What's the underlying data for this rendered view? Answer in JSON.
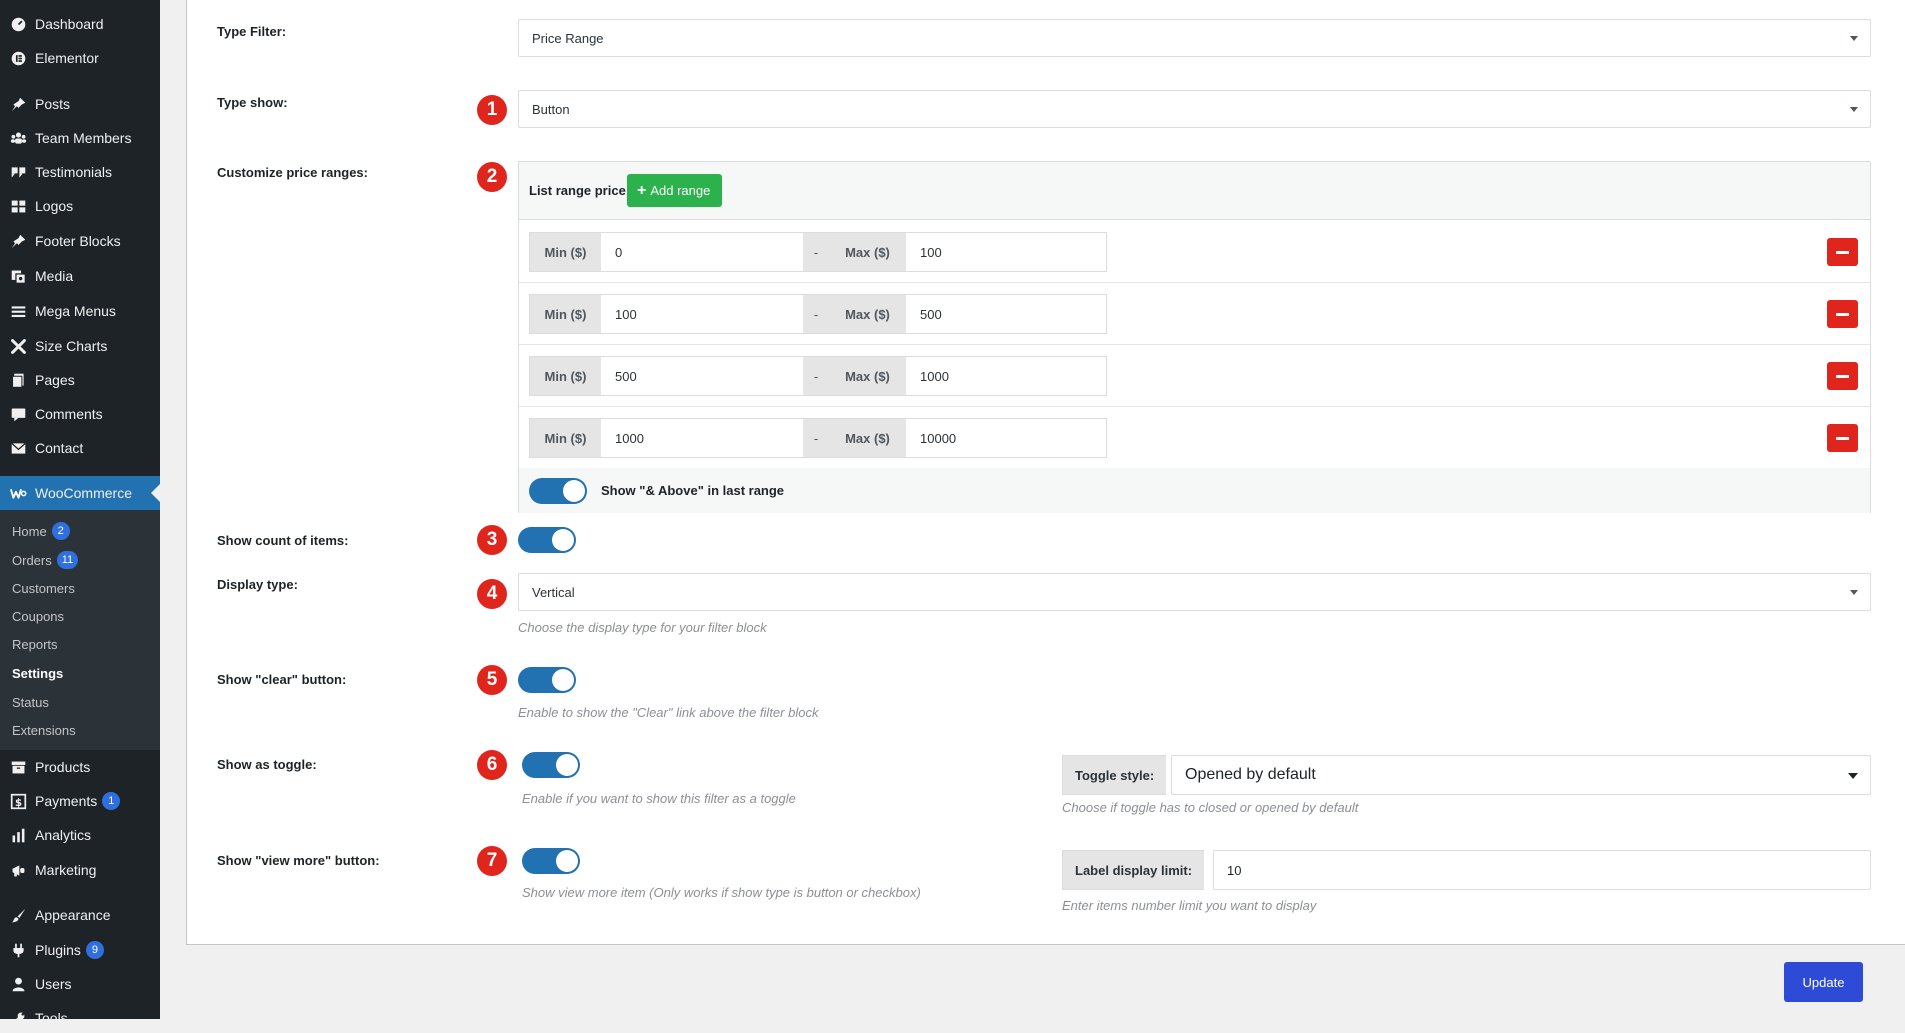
{
  "sidebar": {
    "items": [
      {
        "label": "Dashboard",
        "icon": "dashboard-icon"
      },
      {
        "label": "Elementor",
        "icon": "elementor-icon"
      },
      {
        "label": "Posts",
        "icon": "pin-icon"
      },
      {
        "label": "Team Members",
        "icon": "users-group-icon"
      },
      {
        "label": "Testimonials",
        "icon": "quote-icon"
      },
      {
        "label": "Logos",
        "icon": "grid-icon"
      },
      {
        "label": "Footer Blocks",
        "icon": "pin-icon"
      },
      {
        "label": "Media",
        "icon": "media-icon"
      },
      {
        "label": "Mega Menus",
        "icon": "menu-lines-icon"
      },
      {
        "label": "Size Charts",
        "icon": "tools-icon"
      },
      {
        "label": "Pages",
        "icon": "pages-icon"
      },
      {
        "label": "Comments",
        "icon": "comment-icon"
      },
      {
        "label": "Contact",
        "icon": "mail-icon"
      },
      {
        "label": "WooCommerce",
        "icon": "woo-icon"
      }
    ],
    "woocommerce_submenu": [
      {
        "label": "Home",
        "count": "2"
      },
      {
        "label": "Orders",
        "count": "11"
      },
      {
        "label": "Customers"
      },
      {
        "label": "Coupons"
      },
      {
        "label": "Reports"
      },
      {
        "label": "Settings"
      },
      {
        "label": "Status"
      },
      {
        "label": "Extensions"
      }
    ],
    "bottom_items": [
      {
        "label": "Products",
        "icon": "archive-icon"
      },
      {
        "label": "Payments",
        "icon": "dollar-icon",
        "count": "1"
      },
      {
        "label": "Analytics",
        "icon": "bar-chart-icon"
      },
      {
        "label": "Marketing",
        "icon": "megaphone-icon"
      },
      {
        "label": "Appearance",
        "icon": "brush-icon"
      },
      {
        "label": "Plugins",
        "icon": "plug-icon",
        "count": "9"
      },
      {
        "label": "Users",
        "icon": "user-icon"
      },
      {
        "label": "Tools",
        "icon": "wrench-icon"
      }
    ]
  },
  "form": {
    "type_filter": {
      "label": "Type Filter:",
      "value": "Price Range"
    },
    "type_show": {
      "badge": "1",
      "label": "Type show:",
      "value": "Button"
    },
    "price_ranges": {
      "badge": "2",
      "label": "Customize price ranges:",
      "title": "List range price",
      "add_button": "Add range",
      "min_label": "Min ($)",
      "max_label": "Max ($)",
      "separator": "-",
      "rows": [
        {
          "min": "0",
          "max": "100"
        },
        {
          "min": "100",
          "max": "500"
        },
        {
          "min": "500",
          "max": "1000"
        },
        {
          "min": "1000",
          "max": "10000"
        }
      ],
      "show_above_label": "Show \"& Above\" in last range",
      "show_above_on": true
    },
    "show_count": {
      "badge": "3",
      "label": "Show count of items:",
      "on": true
    },
    "display_type": {
      "badge": "4",
      "label": "Display type:",
      "value": "Vertical",
      "desc": "Choose the display type for your filter block"
    },
    "show_clear": {
      "badge": "5",
      "label": "Show \"clear\" button:",
      "on": true,
      "desc": "Enable to show the \"Clear\" link above the filter block"
    },
    "show_toggle": {
      "badge": "6",
      "label": "Show as toggle:",
      "on": true,
      "desc": "Enable if you want to show this filter as a toggle",
      "style_label": "Toggle style:",
      "style_value": "Opened by default",
      "style_desc": "Choose if toggle has to closed or opened by default"
    },
    "view_more": {
      "badge": "7",
      "label": "Show \"view more\" button:",
      "on": true,
      "desc": "Show view more item (Only works if show type is button or checkbox)",
      "limit_label": "Label display limit:",
      "limit_value": "10",
      "limit_desc": "Enter items number limit you want to display"
    }
  },
  "update_button": "Update",
  "colors": {
    "sidebar_bg": "#1d2327",
    "active_menu": "#2271b1",
    "badge_red": "#e0261c",
    "add_green": "#2bb24c",
    "toggle_blue": "#2271b1",
    "update_blue": "#2d4bd6"
  }
}
